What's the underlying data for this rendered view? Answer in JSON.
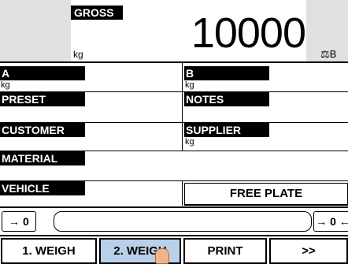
{
  "display": {
    "gross_label": "GROSS",
    "weight_value": "10000",
    "unit": "kg",
    "scale_indicator": "B",
    "scale_icon": "scale-icon"
  },
  "fields": {
    "a": {
      "label": "A",
      "sub": "kg"
    },
    "b": {
      "label": "B",
      "sub": "kg"
    },
    "preset": {
      "label": "PRESET"
    },
    "notes": {
      "label": "NOTES"
    },
    "customer": {
      "label": "CUSTOMER"
    },
    "supplier": {
      "label": "SUPPLIER",
      "sub": "kg"
    },
    "material": {
      "label": "MATERIAL"
    },
    "vehicle": {
      "label": "VEHICLE"
    }
  },
  "free_plate_label": "FREE PLATE",
  "zero": {
    "left_label": "→ 0 ←",
    "right_label": "→ 0 ←"
  },
  "buttons": {
    "weigh1": "1. WEIGH",
    "weigh2": "2. WEIGH",
    "print": "PRINT",
    "next": ">>"
  },
  "colors": {
    "active_button": "#b9d0e8",
    "panel_gray": "#e0e0e0"
  }
}
